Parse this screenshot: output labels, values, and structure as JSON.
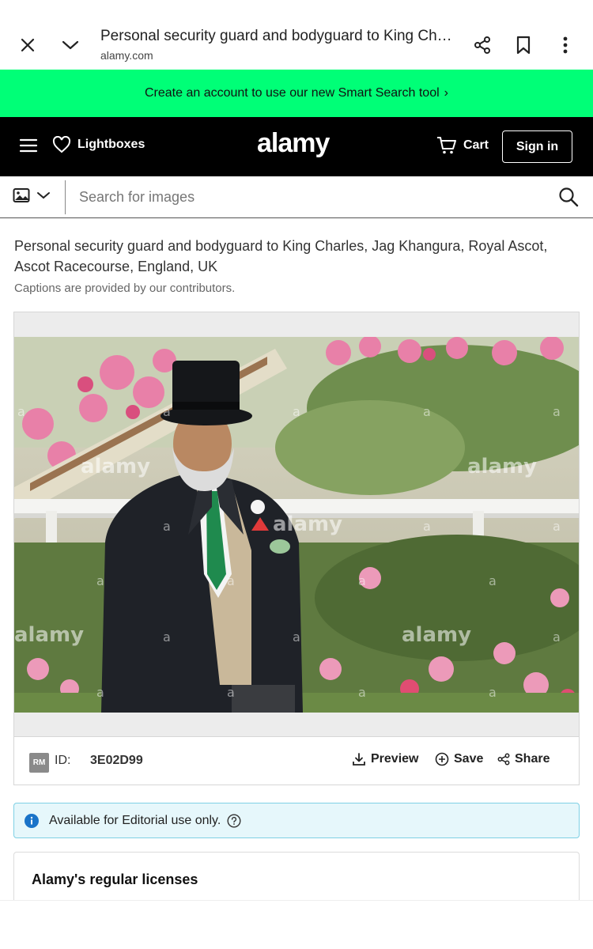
{
  "browser": {
    "page_title": "Personal security guard and bodyguard to King Charl...",
    "url": "alamy.com"
  },
  "promo": {
    "text": "Create an account to use our new Smart Search tool",
    "chevron": "›"
  },
  "header": {
    "lightboxes_label": "Lightboxes",
    "logo": "alamy",
    "cart_label": "Cart",
    "signin_label": "Sign in"
  },
  "search": {
    "placeholder": "Search for images"
  },
  "image": {
    "caption": "Personal security guard and bodyguard to King Charles, Jag Khangura, Royal Ascot, Ascot Racecourse, England, UK",
    "caption_note": "Captions are provided by our contributors.",
    "watermark": "alamy",
    "license_badge": "RM",
    "id_label": "ID:",
    "id_value": "3E02D99"
  },
  "actions": {
    "preview_label": "Preview",
    "save_label": "Save",
    "share_label": "Share"
  },
  "notice": {
    "text": "Available for Editorial use only."
  },
  "licenses": {
    "title": "Alamy's regular licenses"
  },
  "colors": {
    "promo_bg": "#00ff77",
    "header_bg": "#000000",
    "notice_bg": "#e6f7fb",
    "notice_border": "#7fd0e4",
    "info_icon": "#1a73c8"
  }
}
